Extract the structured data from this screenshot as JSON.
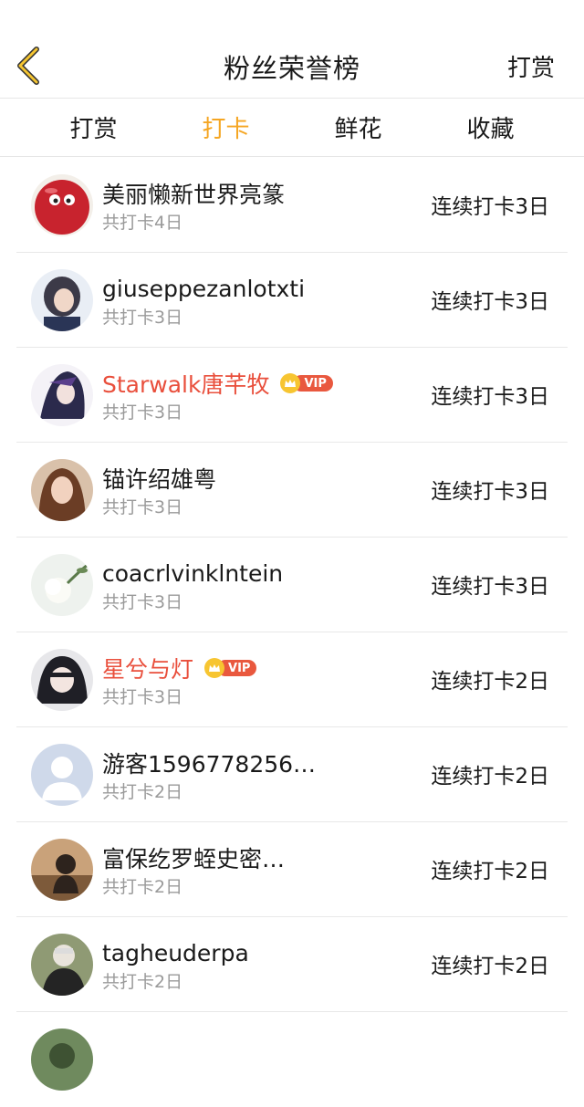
{
  "header": {
    "title": "粉丝荣誉榜",
    "right_action": "打赏",
    "back_icon": "chevron-left-icon",
    "back_color": "#f5a623"
  },
  "tabs": [
    {
      "label": "打赏",
      "active": false
    },
    {
      "label": "打卡",
      "active": true
    },
    {
      "label": "鲜花",
      "active": false
    },
    {
      "label": "收藏",
      "active": false
    }
  ],
  "accent_color": "#f5a623",
  "vip_name_color": "#e94f3c",
  "vip_badge_text": "VIP",
  "fans": [
    {
      "name": "美丽懒新世界亮篆",
      "total": "共打卡4日",
      "streak": "连续打卡3日",
      "vip": false
    },
    {
      "name": "giuseppezanlotxti",
      "total": "共打卡3日",
      "streak": "连续打卡3日",
      "vip": false
    },
    {
      "name": "Starwalk唐芊牧",
      "total": "共打卡3日",
      "streak": "连续打卡3日",
      "vip": true
    },
    {
      "name": "锚许绍雄粤",
      "total": "共打卡3日",
      "streak": "连续打卡3日",
      "vip": false
    },
    {
      "name": "coacrlvinklntein",
      "total": "共打卡3日",
      "streak": "连续打卡3日",
      "vip": false
    },
    {
      "name": "星兮与灯",
      "total": "共打卡3日",
      "streak": "连续打卡2日",
      "vip": true
    },
    {
      "name": "游客1596778256…",
      "total": "共打卡2日",
      "streak": "连续打卡2日",
      "vip": false
    },
    {
      "name": "富保纥罗蛭史密…",
      "total": "共打卡2日",
      "streak": "连续打卡2日",
      "vip": false
    },
    {
      "name": "tagheuderpa",
      "total": "共打卡2日",
      "streak": "连续打卡2日",
      "vip": false
    }
  ]
}
